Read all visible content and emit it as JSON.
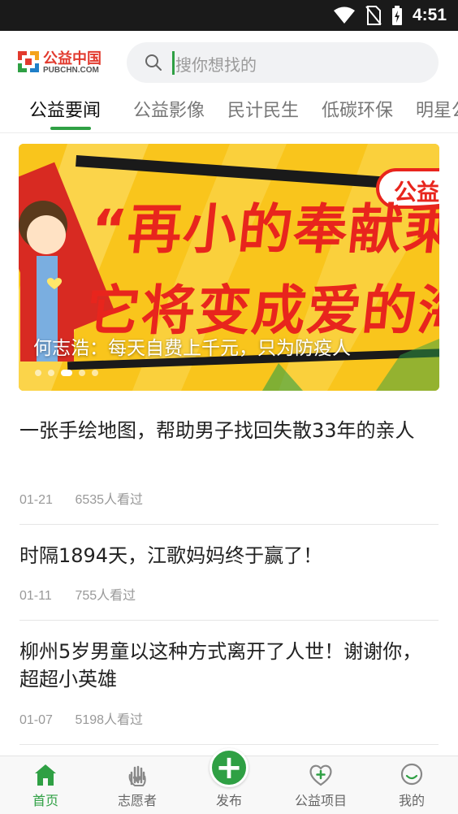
{
  "status_bar": {
    "time": "4:51"
  },
  "header": {
    "logo_cn": "公益中国",
    "logo_en": "PUBCHN.COM",
    "search_placeholder": "搜你想找的"
  },
  "tabs": [
    {
      "label": "公益要闻",
      "active": true
    },
    {
      "label": "公益影像",
      "active": false
    },
    {
      "label": "民计民生",
      "active": false
    },
    {
      "label": "低碳环保",
      "active": false
    },
    {
      "label": "明星公",
      "active": false
    }
  ],
  "banner": {
    "badge": "公益",
    "headline_line1": "“再小的奉献乘以",
    "headline_line2": "它将变成爱的海",
    "caption": "何志浩：每天自费上千元，只为防疫人",
    "dot_count": 5,
    "active_dot": 2
  },
  "news": [
    {
      "title": "一张手绘地图，帮助男子找回失散33年的亲人",
      "date": "01-21",
      "views": "6535人看过"
    },
    {
      "title": "时隔1894天，江歌妈妈终于赢了！",
      "date": "01-11",
      "views": "755人看过"
    },
    {
      "title": "柳州5岁男童以这种方式离开了人世！谢谢你，超超小英雄",
      "date": "01-07",
      "views": "5198人看过"
    }
  ],
  "bottom_nav": {
    "home": "首页",
    "volunteer": "志愿者",
    "publish": "发布",
    "projects": "公益项目",
    "mine": "我的"
  },
  "colors": {
    "brand_green": "#2fa044",
    "brand_red": "#e23a2e",
    "banner_yellow": "#f9c51c"
  }
}
